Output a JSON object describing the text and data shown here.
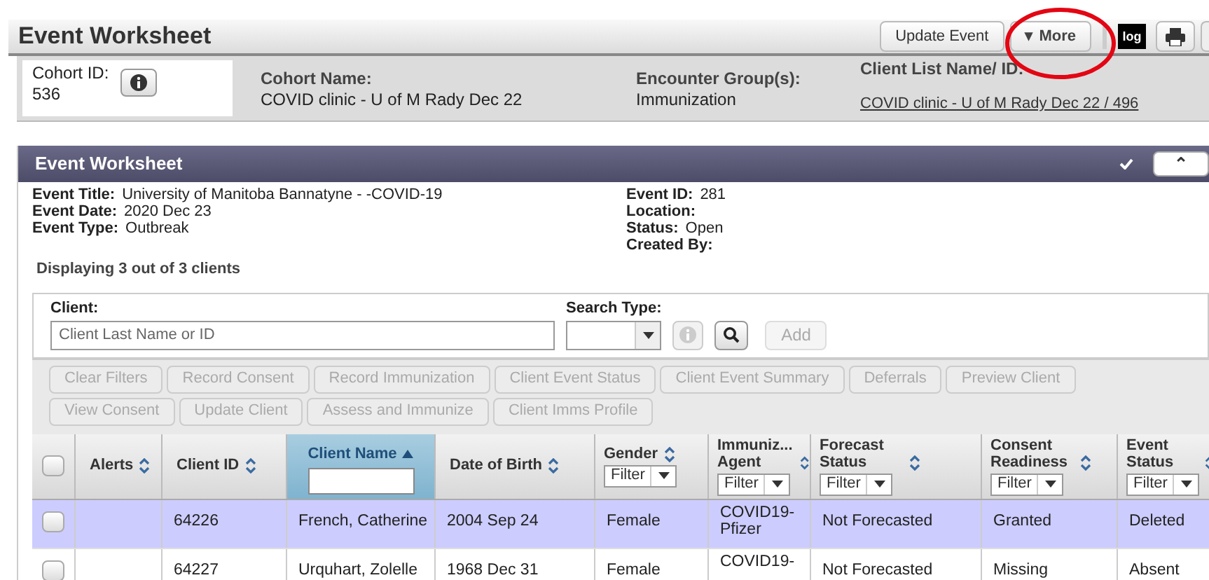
{
  "title": "Event Worksheet",
  "toolbar": {
    "buttons": [
      "Update Event",
      "More"
    ],
    "more_icon": "▾",
    "log_label": "log"
  },
  "annotation": {
    "kind": "circle",
    "color": "#e30613"
  },
  "cohort": {
    "id_label": "Cohort ID:",
    "id": "536",
    "name_label": "Cohort Name:",
    "name": "COVID clinic - U of M Rady Dec 22",
    "group_label": "Encounter Group(s):",
    "group": "Immunization",
    "list_label": "Client List Name/ ID:",
    "list_link": "COVID clinic - U of M Rady Dec 22 / 496"
  },
  "panel": {
    "title": "Event Worksheet",
    "collapse_icon": "⌃"
  },
  "event_left": [
    {
      "label": "Event Title:",
      "value": "University of Manitoba Bannatyne - -COVID-19"
    },
    {
      "label": "Event Date:",
      "value": "2020 Dec 23"
    },
    {
      "label": "Event Type:",
      "value": "Outbreak"
    }
  ],
  "event_right": [
    {
      "label": "Event ID:",
      "value": "281"
    },
    {
      "label": "Location:"
    },
    {
      "label": "Status:",
      "value": "Open"
    },
    {
      "label": "Created By:"
    }
  ],
  "count_text": "Displaying 3 out of 3 clients",
  "search": {
    "client_label": "Client:",
    "placeholder": "Client Last Name or ID",
    "type_label": "Search Type:",
    "add": "Add",
    "add_disabled": true
  },
  "actions": [
    [
      {
        "label": "Clear Filters",
        "disabled": true
      },
      {
        "label": "Record Consent",
        "disabled": true
      },
      {
        "label": "Record Immunization",
        "disabled": true
      },
      {
        "label": "Client Event Status",
        "disabled": true
      },
      {
        "label": "Client Event Summary",
        "disabled": true
      },
      {
        "label": "Deferrals",
        "disabled": true
      },
      {
        "label": "Preview Client",
        "disabled": true
      }
    ],
    [
      {
        "label": "View Consent",
        "disabled": true
      },
      {
        "label": "Update Client",
        "disabled": true
      },
      {
        "label": "Assess and Immunize",
        "disabled": true
      },
      {
        "label": "Client Imms Profile",
        "disabled": true
      }
    ]
  ],
  "columns": [
    {
      "kind": "checkbox",
      "checked": false
    },
    {
      "kind": "sort",
      "label": "Alerts"
    },
    {
      "kind": "sort",
      "label": "Client ID"
    },
    {
      "kind": "sorted",
      "label": "Client Name"
    },
    {
      "kind": "sort",
      "label": "Date of Birth"
    },
    {
      "kind": "filter",
      "label": "Gender",
      "filter": "Filter"
    },
    {
      "kind": "filter",
      "label": "Immuniz... Agent",
      "filter": "Filter"
    },
    {
      "kind": "filter",
      "label": "Forecast Status",
      "filter": "Filter"
    },
    {
      "kind": "filter",
      "label": "Consent Readiness",
      "filter": "Filter"
    },
    {
      "kind": "filter",
      "label": "Event Status",
      "filter": "Filter"
    }
  ],
  "rows": [
    {
      "selected": true,
      "checked": false,
      "cells": [
        "",
        "64226",
        "French, Catherine",
        "2004 Sep 24",
        "Female",
        "COVID19-Pfizer",
        "Not Forecasted",
        "Granted",
        "Deleted"
      ]
    },
    {
      "selected": false,
      "checked": false,
      "cells": [
        "",
        "64227",
        "Urquhart, Zolelle",
        "1968 Dec 31",
        "Female",
        "COVID19-",
        "Not Forecasted",
        "Missing",
        "Absent"
      ]
    }
  ]
}
